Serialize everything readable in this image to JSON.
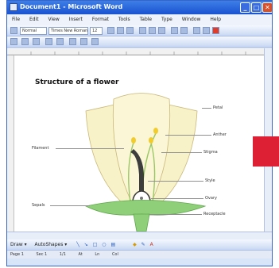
{
  "window": {
    "title": "Document1 - Microsoft Word",
    "minimize": "_",
    "maximize": "□",
    "close": "✕"
  },
  "menu": [
    "File",
    "Edit",
    "View",
    "Insert",
    "Format",
    "Tools",
    "Table",
    "Type",
    "Window",
    "Help"
  ],
  "formatting": {
    "style": "Normal",
    "font": "Times New Roman",
    "size": "12"
  },
  "document": {
    "title": "Structure of a flower",
    "labels": {
      "petal": "Petal",
      "anther": "Anther",
      "stigma": "Stigma",
      "filament": "Filament",
      "style": "Style",
      "ovary": "Ovary",
      "sepals": "Sepals",
      "receptacle": "Receptacle"
    }
  },
  "drawing_toolbar": {
    "draw": "Draw ▾",
    "autoshapes": "AutoShapes ▾"
  },
  "status": {
    "page": "Page 1",
    "section": "Sec 1",
    "pages": "1/1",
    "at": "At",
    "ln": "Ln",
    "col": "Col"
  },
  "colors": {
    "petal_fill": "#f8f2c8",
    "sepal_fill": "#8fcf7a",
    "accent_red": "#dd2033"
  }
}
